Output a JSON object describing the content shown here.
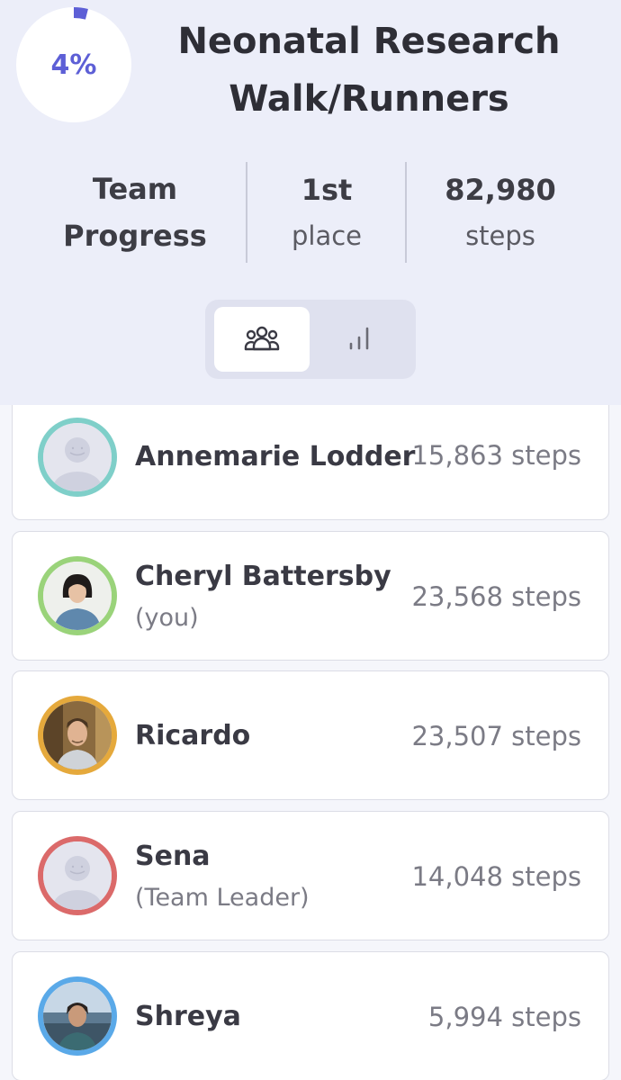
{
  "team": {
    "name_line1": "Neonatal Research",
    "name_line2": "Walk/Runners",
    "progress_percent": 4,
    "progress_label": "4%",
    "accent_color": "#5d5fd6"
  },
  "stats": {
    "progress_line1": "Team",
    "progress_line2": "Progress",
    "place_value": "1st",
    "place_label": "place",
    "steps_value": "82,980",
    "steps_label": "steps"
  },
  "view_toggle": {
    "selected": "members",
    "options": [
      {
        "id": "members",
        "icon": "group-icon"
      },
      {
        "id": "stats",
        "icon": "bar-chart-icon"
      }
    ]
  },
  "members": [
    {
      "name": "Annemarie Lodder",
      "subtitle": "",
      "steps": "15,863 steps",
      "ring_color": "#7fcfc9",
      "photo": "placeholder"
    },
    {
      "name": "Cheryl Battersby",
      "subtitle": "(you)",
      "steps": "23,568 steps",
      "ring_color": "#9ad37a",
      "photo": "woman-portrait"
    },
    {
      "name": "Ricardo",
      "subtitle": "",
      "steps": "23,507 steps",
      "ring_color": "#e5a93c",
      "photo": "man-portrait"
    },
    {
      "name": "Sena",
      "subtitle": "(Team Leader)",
      "steps": "14,048 steps",
      "ring_color": "#db6a6a",
      "photo": "placeholder"
    },
    {
      "name": "Shreya",
      "subtitle": "",
      "steps": "5,994 steps",
      "ring_color": "#5aa9e8",
      "photo": "outdoor-portrait"
    }
  ]
}
